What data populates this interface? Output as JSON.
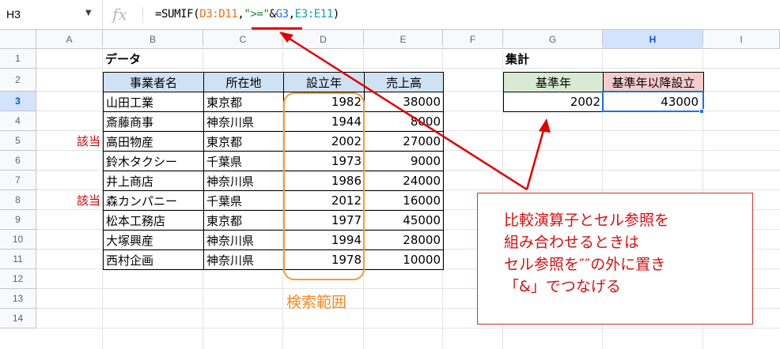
{
  "formula_bar": {
    "cell_ref": "H3",
    "fx_label": "fx",
    "formula_parts": [
      {
        "text": "=SUMIF(",
        "color": "#000000"
      },
      {
        "text": "D3:D11",
        "color": "#e8711a"
      },
      {
        "text": ",",
        "color": "#000000"
      },
      {
        "text": "\">=\"",
        "color": "#188038"
      },
      {
        "text": "&",
        "color": "#000000"
      },
      {
        "text": "G3",
        "color": "#1a73e8"
      },
      {
        "text": ",",
        "color": "#000000"
      },
      {
        "text": "E3:E11",
        "color": "#129eaf"
      },
      {
        "text": ")",
        "color": "#000000"
      }
    ]
  },
  "columns": [
    "A",
    "B",
    "C",
    "D",
    "E",
    "F",
    "G",
    "H",
    "I"
  ],
  "rows": [
    "1",
    "2",
    "3",
    "4",
    "5",
    "6",
    "7",
    "8",
    "9",
    "10",
    "11",
    "12",
    "13",
    "14"
  ],
  "selected": {
    "column": "H",
    "row": "3"
  },
  "data_table": {
    "title": "データ",
    "headers": [
      "事業者名",
      "所在地",
      "設立年",
      "売上高"
    ],
    "rows": [
      [
        "山田工業",
        "東京都",
        "1982",
        "38000"
      ],
      [
        "斎藤商事",
        "神奈川県",
        "1944",
        "8000"
      ],
      [
        "高田物産",
        "東京都",
        "2002",
        "27000"
      ],
      [
        "鈴木タクシー",
        "千葉県",
        "1973",
        "9000"
      ],
      [
        "井上商店",
        "神奈川県",
        "1986",
        "24000"
      ],
      [
        "森カンパニー",
        "千葉県",
        "2012",
        "16000"
      ],
      [
        "松本工務店",
        "東京都",
        "1977",
        "45000"
      ],
      [
        "大塚興産",
        "神奈川県",
        "1994",
        "28000"
      ],
      [
        "西村企画",
        "神奈川県",
        "1978",
        "10000"
      ]
    ]
  },
  "match_labels": {
    "row5": "該当",
    "row8": "該当"
  },
  "summary": {
    "title": "集計",
    "header_g": "基準年",
    "header_h": "基準年以降設立",
    "value_g": "2002",
    "value_h": "43000"
  },
  "search_range_label": "検索範囲",
  "note_lines": [
    "比較演算子とセル参照を",
    "組み合わせるときは",
    "セル参照を″″の外に置き",
    "「&」でつなげる"
  ],
  "colors": {
    "annotation_red": "#d51010",
    "range_orange": "#f59a3b",
    "selection_blue": "#1a73e8",
    "header_blue": "#cfe2f3",
    "header_green": "#d9ead3",
    "header_red": "#f4cccc"
  }
}
